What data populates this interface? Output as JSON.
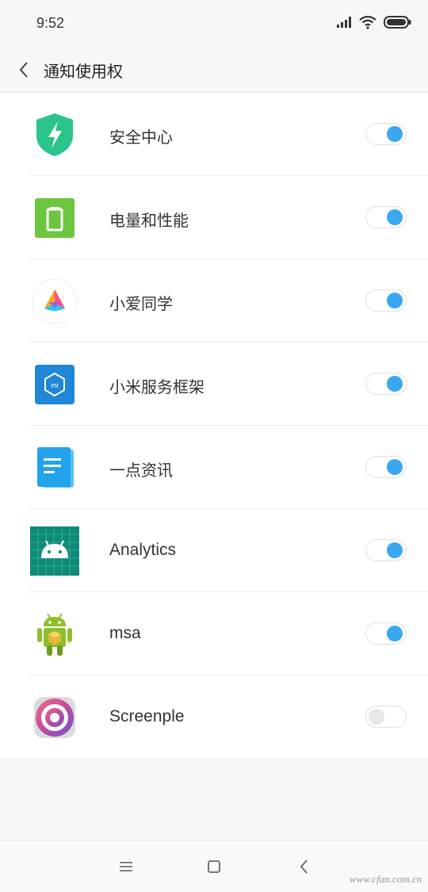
{
  "status_bar": {
    "time": "9:52"
  },
  "header": {
    "title": "通知使用权"
  },
  "apps": [
    {
      "name": "安全中心",
      "icon": "security-shield-icon",
      "enabled": true
    },
    {
      "name": "电量和性能",
      "icon": "battery-icon",
      "enabled": true
    },
    {
      "name": "小爱同学",
      "icon": "xiaoai-icon",
      "enabled": true
    },
    {
      "name": "小米服务框架",
      "icon": "mi-service-icon",
      "enabled": true
    },
    {
      "name": "一点资讯",
      "icon": "document-icon",
      "enabled": true
    },
    {
      "name": "Analytics",
      "icon": "android-icon",
      "enabled": true
    },
    {
      "name": "msa",
      "icon": "android-robot-icon",
      "enabled": true
    },
    {
      "name": "Screenple",
      "icon": "screenple-icon",
      "enabled": false
    }
  ],
  "watermark": "www.cfan.com.cn",
  "colors": {
    "accent": "#3aa8f0",
    "shield": "#2bc48a",
    "battery": "#6cc63f",
    "mi_blue": "#1f86d8"
  }
}
